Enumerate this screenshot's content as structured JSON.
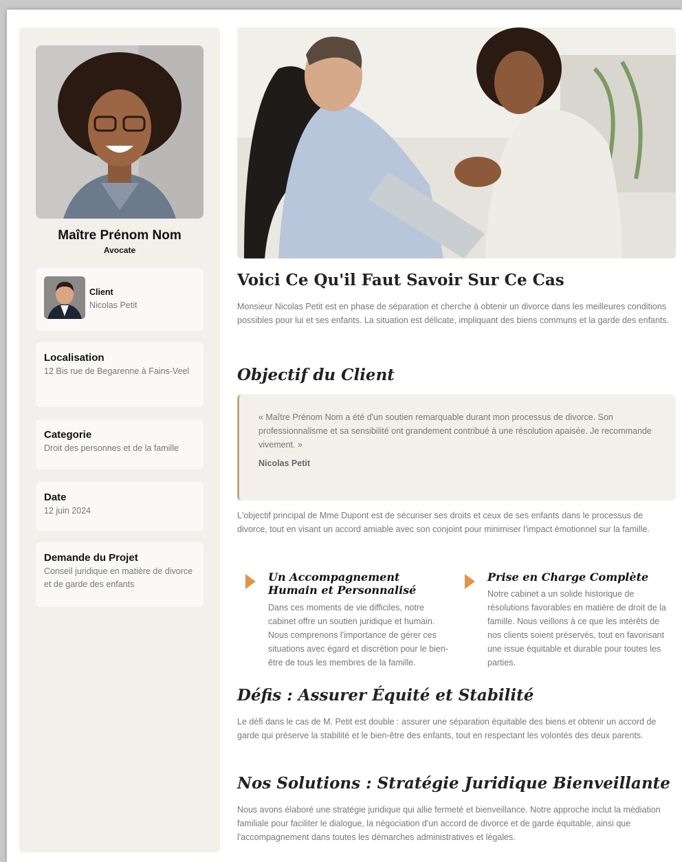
{
  "sidebar": {
    "name": "Maître Prénom Nom",
    "role": "Avocate",
    "client": {
      "title": "Client",
      "value": "Nicolas Petit"
    },
    "localisation": {
      "title": "Localisation",
      "value": "12 Bis rue de Begarenne à Fains-Veel"
    },
    "categorie": {
      "title": "Categorie",
      "value": "Droit des personnes et de la famille"
    },
    "date": {
      "title": "Date",
      "value": "12 juin 2024"
    },
    "demande": {
      "title": "Demande du Projet",
      "value": "Conseil juridique en matière de divorce et de garde des enfants"
    }
  },
  "main": {
    "title": "Voici Ce Qu'il Faut Savoir Sur Ce Cas",
    "intro": "Monsieur Nicolas Petit est en phase de séparation et cherche à obtenir un divorce dans les meilleures conditions possibles pour lui et ses enfants. La situation est délicate, impliquant des biens communs et la garde des enfants.",
    "objective_heading": "Objectif du Client",
    "quote_text": "« Maître Prénom Nom a été d'un soutien remarquable durant mon processus de divorce. Son professionnalisme et sa sensibilité ont grandement contribué à une résolution apaisée. Je recommande vivement. »",
    "quote_author": "Nicolas Petit",
    "objective_text": "L'objectif principal de Mme Dupont est de sécuriser ses droits et ceux de ses enfants dans le processus de divorce, tout en visant un accord amiable avec son conjoint pour minimiser l'impact émotionnel sur la famille.",
    "features": [
      {
        "title": "Un Accompagnement Humain et Personnalisé",
        "text": "Dans ces moments de vie difficiles, notre cabinet offre un soutien juridique et humain. Nous comprenons l'importance de gérer ces situations avec égard et discrétion pour le bien-être de tous les membres de la famille."
      },
      {
        "title": "Prise en Charge Complète",
        "text": "Notre cabinet a un solide historique de résolutions favorables en matière de droit de la famille. Nous veillons à ce que les intérêts de nos clients soient préservés, tout en favorisant une issue équitable et durable pour toutes les parties."
      }
    ],
    "defis_heading": "Défis : Assurer Équité et Stabilité",
    "defis_text": "Le défi dans le cas de M. Petit est double : assurer une séparation équitable des biens et obtenir un accord de garde qui préserve la stabilité et le bien-être des enfants, tout en respectant les volontés des deux parents.",
    "solutions_heading": "Nos Solutions : Stratégie Juridique Bienveillante",
    "solutions_text": "Nous avons élaboré une stratégie juridique qui allie fermeté et bienveillance. Notre approche inclut la médiation familiale pour faciliter le dialogue, la négociation d'un accord de divorce et de garde équitable, ainsi que l'accompagnement dans toutes les démarches administratives et légales."
  },
  "colors": {
    "accent": "#e09646",
    "quote_border": "#c9a57a",
    "panel_bg": "#f3efeb"
  }
}
